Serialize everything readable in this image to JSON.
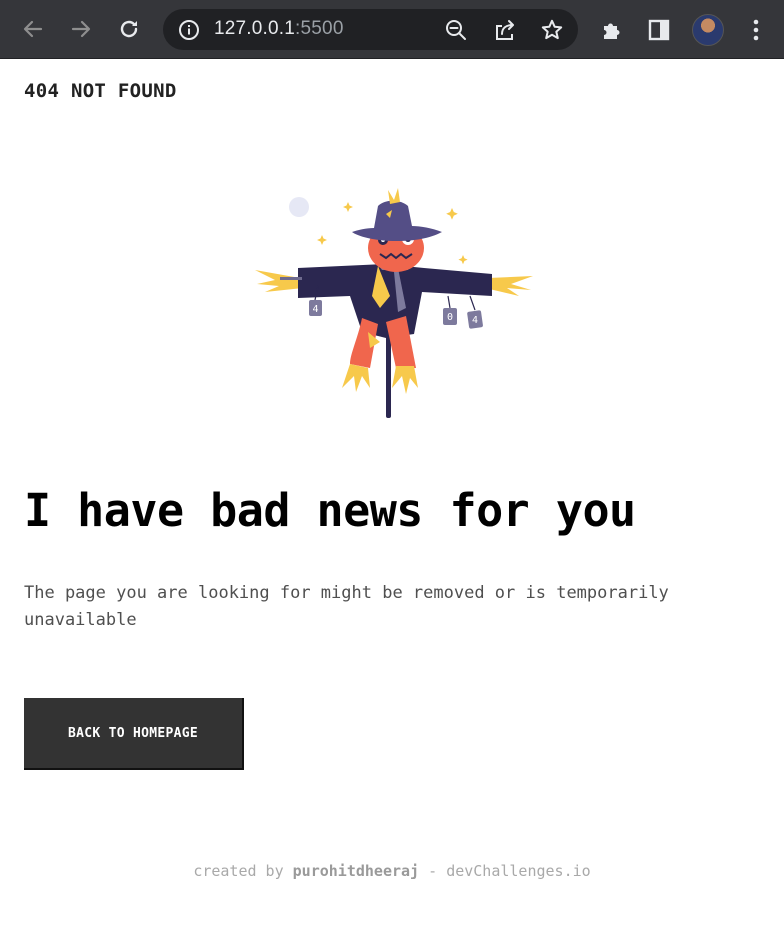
{
  "browser": {
    "url_host": "127.0.0.1",
    "url_port": ":5500",
    "icons": [
      "back-arrow-icon",
      "forward-arrow-icon",
      "reload-icon",
      "site-info-icon",
      "zoom-out-icon",
      "share-icon",
      "bookmark-star-icon",
      "extensions-puzzle-icon",
      "side-panel-icon",
      "profile-avatar",
      "more-menu-icon"
    ]
  },
  "page": {
    "label": "404 NOT FOUND",
    "headline": "I have bad news for you",
    "description": "The page you are looking for might be removed or is temporarily unavailable",
    "button_label": "BACK TO HOMEPAGE",
    "illustration": {
      "sign_digits": [
        "4",
        "0",
        "4"
      ]
    }
  },
  "footer": {
    "prefix": "created by",
    "author": "purohitdheeraj",
    "separator": " - ",
    "site": "devChallenges.io"
  },
  "colors": {
    "chrome_bg": "#35363a",
    "omnibox_bg": "#202124",
    "button_bg": "#333333",
    "scarecrow_coat": "#2b2750",
    "scarecrow_face": "#f0664d",
    "straw": "#f7c94b"
  }
}
